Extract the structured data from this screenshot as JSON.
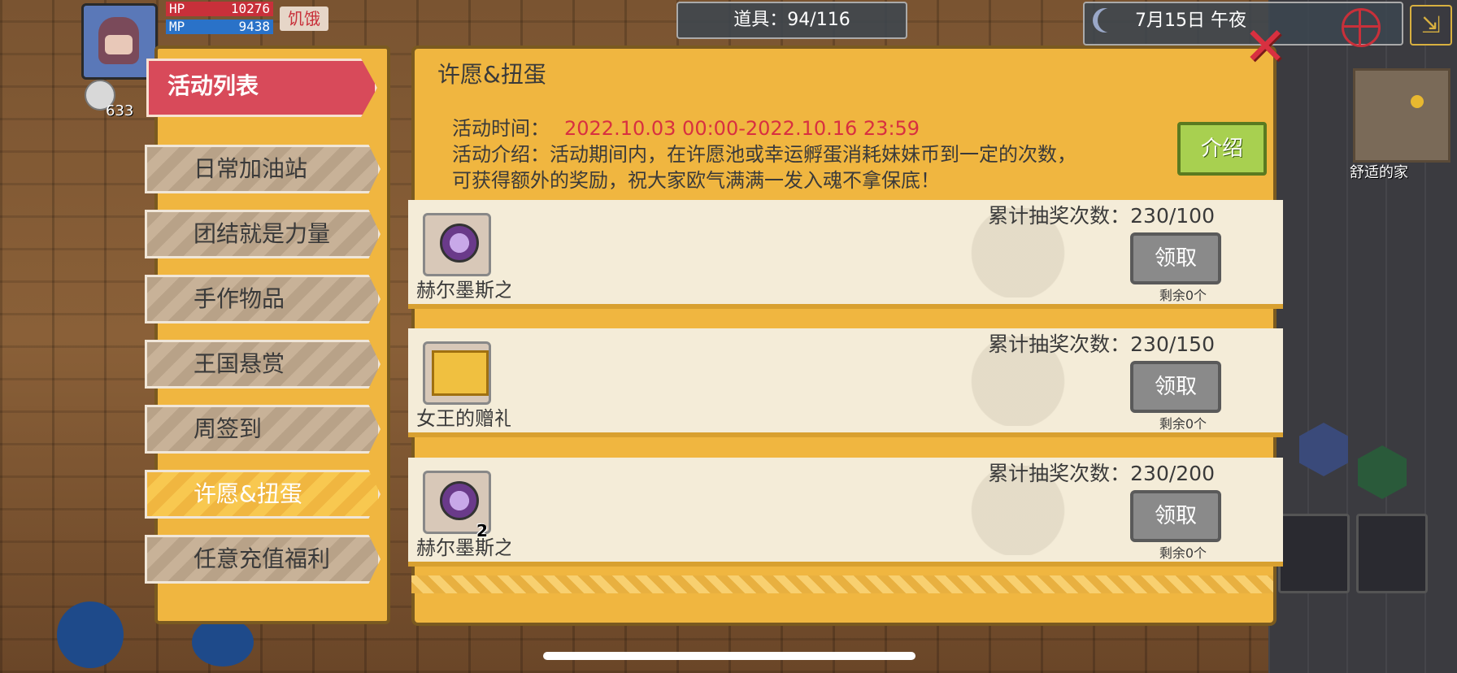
{
  "hud": {
    "hp_label": "HP",
    "hp_value": "10276",
    "mp_label": "MP",
    "mp_value": "9438",
    "status": "饥饿",
    "currency": "633",
    "items": "道具：94/116",
    "date_time": "7月15日 午夜",
    "location": "舒适的家"
  },
  "tabs": {
    "header": "活动列表",
    "items": [
      {
        "label": "日常加油站",
        "active": false
      },
      {
        "label": "团结就是力量",
        "active": false
      },
      {
        "label": "手作物品",
        "active": false
      },
      {
        "label": "王国悬赏",
        "active": false
      },
      {
        "label": "周签到",
        "active": false
      },
      {
        "label": "许愿&扭蛋",
        "active": true
      },
      {
        "label": "任意充值福利",
        "active": false
      }
    ]
  },
  "event": {
    "title": "许愿&扭蛋",
    "time_label": "活动时间：",
    "time_value": "2022.10.03 00:00-2022.10.16 23:59",
    "desc_line1": "活动介绍：活动期间内，在许愿池或幸运孵蛋消耗妹妹币到一定的次数，",
    "desc_line2": "可获得额外的奖励，祝大家欧气满满一发入魂不拿保底！",
    "intro_button": "介绍"
  },
  "rewards": [
    {
      "name": "赫尔墨斯之",
      "icon": "potion-orb-icon",
      "count": "",
      "progress": "累计抽奖次数：230/100",
      "button": "领取",
      "remaining": "剩余0个"
    },
    {
      "name": "女王的赠礼",
      "icon": "golden-gift-icon",
      "count": "",
      "progress": "累计抽奖次数：230/150",
      "button": "领取",
      "remaining": "剩余0个"
    },
    {
      "name": "赫尔墨斯之",
      "icon": "potion-orb-icon",
      "count": "2",
      "progress": "累计抽奖次数：230/200",
      "button": "领取",
      "remaining": "剩余0个"
    }
  ],
  "colors": {
    "panel": "#f0b640",
    "accent_red": "#d83040",
    "tab_header": "#d84a5a",
    "intro_green": "#a8d050",
    "claim_gray": "#8a8a8a"
  }
}
